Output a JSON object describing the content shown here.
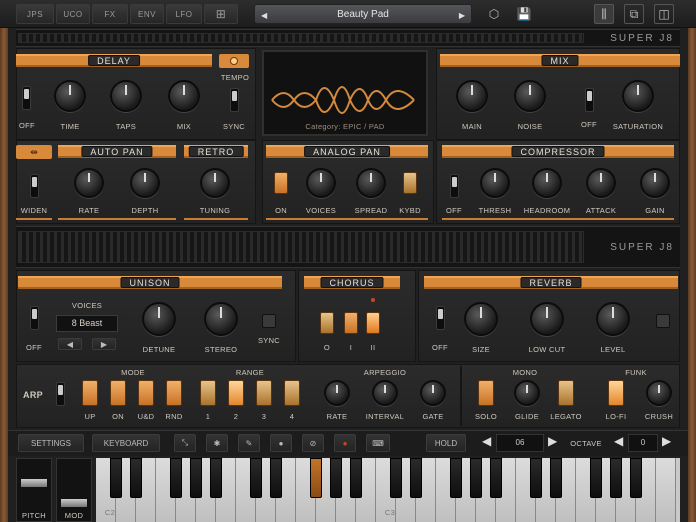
{
  "topbar": {
    "tabs": [
      "JPS",
      "UCO",
      "FX",
      "ENV",
      "LFO"
    ],
    "preset": "Beauty Pad"
  },
  "brand": "SUPER J8",
  "delay": {
    "title": "DELAY",
    "tempo": "TEMPO",
    "labels": [
      "OFF",
      "TIME",
      "TAPS",
      "MIX",
      "SYNC"
    ]
  },
  "display": {
    "caption": "Category: EPIC / PAD"
  },
  "mix": {
    "title": "MIX",
    "labels": [
      "MAIN",
      "NOISE",
      "OFF",
      "SATURATION"
    ]
  },
  "autopan": {
    "title": "AUTO PAN",
    "labels": [
      "WIDEN",
      "RATE",
      "DEPTH"
    ]
  },
  "retro": {
    "title": "RETRO",
    "labels": [
      "TUNING"
    ]
  },
  "analogpan": {
    "title": "ANALOG PAN",
    "labels": [
      "ON",
      "VOICES",
      "SPREAD",
      "KYBD"
    ]
  },
  "compressor": {
    "title": "COMPRESSOR",
    "labels": [
      "OFF",
      "THRESH",
      "HEADROOM",
      "ATTACK",
      "GAIN"
    ]
  },
  "unison": {
    "title": "UNISON",
    "voices_label": "VOICES",
    "voices_value": "8 Beast",
    "labels": [
      "OFF",
      "DETUNE",
      "STEREO",
      "SYNC"
    ]
  },
  "chorus": {
    "title": "CHORUS",
    "labels": [
      "O",
      "I",
      "II"
    ]
  },
  "reverb": {
    "title": "REVERB",
    "labels": [
      "OFF",
      "SIZE",
      "LOW CUT",
      "LEVEL"
    ]
  },
  "arp": {
    "title": "ARP",
    "mode": "MODE",
    "range": "RANGE",
    "arpeggio": "ARPEGGIO",
    "mono": "MONO",
    "funk": "FUNK",
    "labels": [
      "UP",
      "ON",
      "U&D",
      "RND",
      "1",
      "2",
      "3",
      "4",
      "RATE",
      "INTERVAL",
      "GATE",
      "SOLO",
      "GLIDE",
      "LEGATO",
      "LO-FI",
      "CRUSH"
    ]
  },
  "bottom": {
    "settings": "SETTINGS",
    "keyboard": "KEYBOARD",
    "hold": "HOLD",
    "value1": "06",
    "octave_label": "OCTAVE",
    "octave_value": "0"
  },
  "keyboard": {
    "pitch": "PITCH",
    "mod": "MOD",
    "notes": [
      "C2",
      "C3"
    ]
  }
}
